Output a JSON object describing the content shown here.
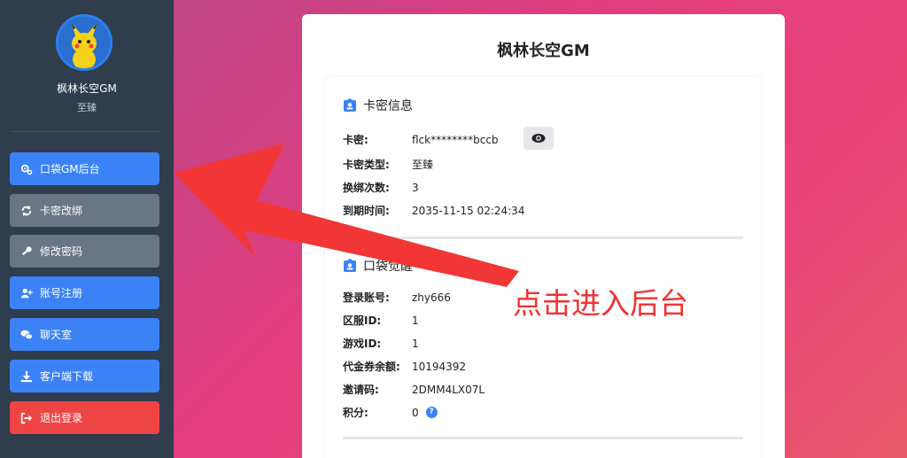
{
  "sidebar": {
    "username": "枫林长空GM",
    "level": "至臻",
    "items": [
      {
        "label": "口袋GM后台"
      },
      {
        "label": "卡密改绑"
      },
      {
        "label": "修改密码"
      },
      {
        "label": "账号注册"
      },
      {
        "label": "聊天室"
      },
      {
        "label": "客户端下载"
      },
      {
        "label": "退出登录"
      }
    ]
  },
  "main": {
    "title": "枫林长空GM",
    "card_info": {
      "title": "卡密信息",
      "rows": [
        {
          "label": "卡密:",
          "value": "flck********bccb"
        },
        {
          "label": "卡密类型:",
          "value": "至臻"
        },
        {
          "label": "换绑次数:",
          "value": "3"
        },
        {
          "label": "到期时间:",
          "value": "2035-11-15 02:24:34"
        }
      ]
    },
    "pocket": {
      "title": "口袋觉醒",
      "rows": [
        {
          "label": "登录账号:",
          "value": "zhy666"
        },
        {
          "label": "区服ID:",
          "value": "1"
        },
        {
          "label": "游戏ID:",
          "value": "1"
        },
        {
          "label": "代金券余额:",
          "value": "10194392"
        },
        {
          "label": "邀请码:",
          "value": "2DMM4LX07L"
        },
        {
          "label": "积分:",
          "value": "0"
        }
      ]
    }
  },
  "annotation": {
    "text": "点击进入后台"
  },
  "icons": {
    "help": "?"
  },
  "colors": {
    "primary": "#3b82f6",
    "danger": "#ef4444",
    "secondary": "#6b7685",
    "sidebar_bg": "#2f3d4d",
    "annotation": "#f23030"
  }
}
